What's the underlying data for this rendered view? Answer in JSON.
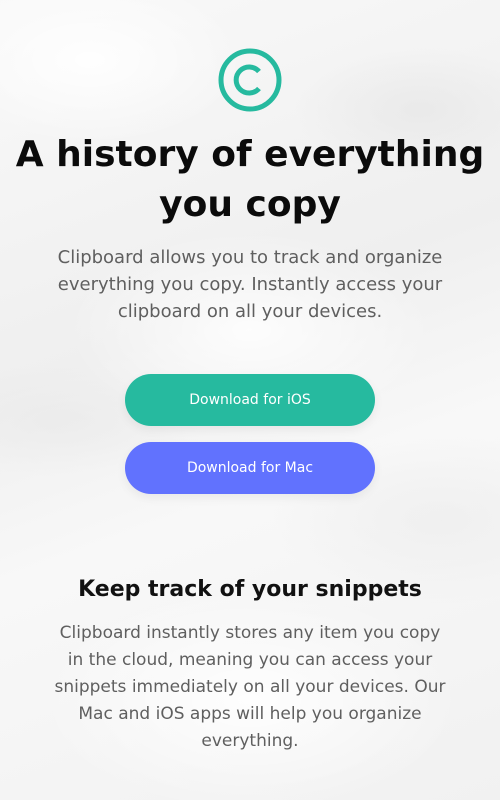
{
  "brand": {
    "logo_icon": "copyright-icon",
    "accent_color": "#26ba9f"
  },
  "hero": {
    "title": "A history of everything you copy",
    "description": "Clipboard allows you to track and organize everything you copy. Instantly access your clipboard on all your devices."
  },
  "downloads": {
    "ios_label": "Download for iOS",
    "ios_color": "#26ba9f",
    "mac_label": "Download for Mac",
    "mac_color": "#6172fe"
  },
  "snippets": {
    "title": "Keep track of your snippets",
    "description": "Clipboard instantly stores any item you copy in the cloud, meaning you can access your snippets immediately on all your devices. Our Mac and iOS apps will help you organize everything."
  }
}
